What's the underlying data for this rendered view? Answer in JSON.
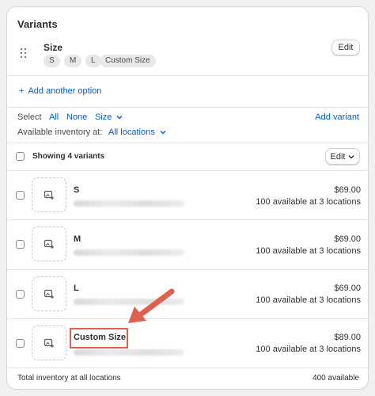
{
  "section": {
    "title": "Variants"
  },
  "option": {
    "name": "Size",
    "values": [
      "S",
      "M",
      "L",
      "Custom Size"
    ],
    "edit_label": "Edit"
  },
  "add_option_label": "Add another option",
  "select_bar": {
    "label": "Select",
    "all": "All",
    "none": "None",
    "size": "Size",
    "add_variant": "Add variant"
  },
  "inventory": {
    "label": "Available inventory at:",
    "location": "All locations"
  },
  "list_header": {
    "showing": "Showing 4 variants",
    "edit_label": "Edit"
  },
  "variants": [
    {
      "name": "S",
      "price": "$69.00",
      "availability": "100 available at 3 locations"
    },
    {
      "name": "M",
      "price": "$69.00",
      "availability": "100 available at 3 locations"
    },
    {
      "name": "L",
      "price": "$69.00",
      "availability": "100 available at 3 locations"
    },
    {
      "name": "Custom Size",
      "price": "$89.00",
      "availability": "100 available at 3 locations"
    }
  ],
  "footer": {
    "label": "Total inventory at all locations",
    "value": "400 available"
  },
  "colors": {
    "link": "#005bd3",
    "annotation": "#e05f4f"
  },
  "icons": [
    "drag-handle-icon",
    "plus-icon",
    "chevron-down-icon",
    "image-add-icon",
    "arrow-annotation-icon"
  ]
}
